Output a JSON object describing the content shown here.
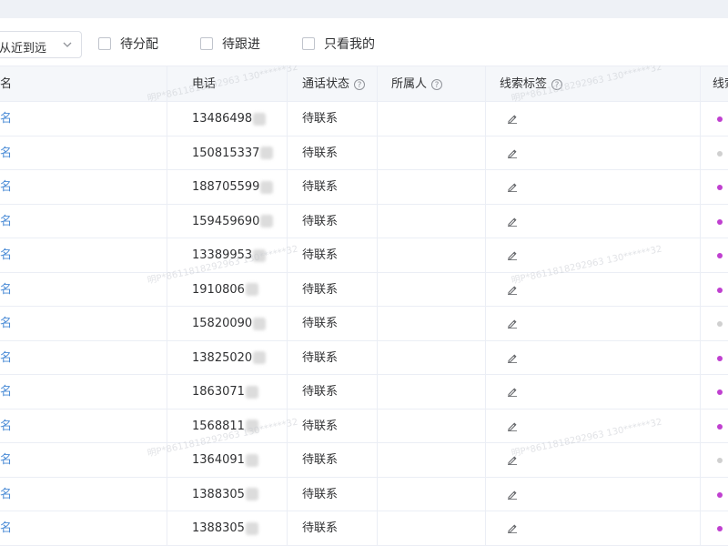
{
  "filter": {
    "sort_select": "从近到远",
    "checkboxes": [
      {
        "label": "待分配"
      },
      {
        "label": "待跟进"
      },
      {
        "label": "只看我的"
      }
    ]
  },
  "table": {
    "headers": {
      "name": "名",
      "phone": "电话",
      "call_status": "通话状态",
      "owner": "所属人",
      "tags": "线索标签",
      "last": "线索"
    },
    "rows": [
      {
        "name": "名",
        "phone": "13486498",
        "status": "待联系",
        "dot": "#c040d0"
      },
      {
        "name": "名",
        "phone": "150815337",
        "status": "待联系",
        "dot": "#d0d0d0"
      },
      {
        "name": "名",
        "phone": "188705599",
        "status": "待联系",
        "dot": "#c040d0"
      },
      {
        "name": "名",
        "phone": "159459690",
        "status": "待联系",
        "dot": "#c040d0"
      },
      {
        "name": "名",
        "phone": "13389953",
        "status": "待联系",
        "dot": "#c040d0"
      },
      {
        "name": "名",
        "phone": "1910806",
        "status": "待联系",
        "dot": "#c040d0"
      },
      {
        "name": "名",
        "phone": "15820090",
        "status": "待联系",
        "dot": "#d0d0d0"
      },
      {
        "name": "名",
        "phone": "13825020",
        "status": "待联系",
        "dot": "#c040d0"
      },
      {
        "name": "名",
        "phone": "1863071",
        "status": "待联系",
        "dot": "#c040d0"
      },
      {
        "name": "名",
        "phone": "1568811",
        "status": "待联系",
        "dot": "#c040d0"
      },
      {
        "name": "名",
        "phone": "1364091",
        "status": "待联系",
        "dot": "#d0d0d0"
      },
      {
        "name": "名",
        "phone": "1388305",
        "status": "待联系",
        "dot": "#c040d0"
      },
      {
        "name": "名",
        "phone": "1388305",
        "status": "待联系",
        "dot": "#c040d0"
      }
    ]
  },
  "colors": {
    "link": "#4a8bd6",
    "header_bg": "#f5f7fa",
    "border": "#ebeef5"
  }
}
